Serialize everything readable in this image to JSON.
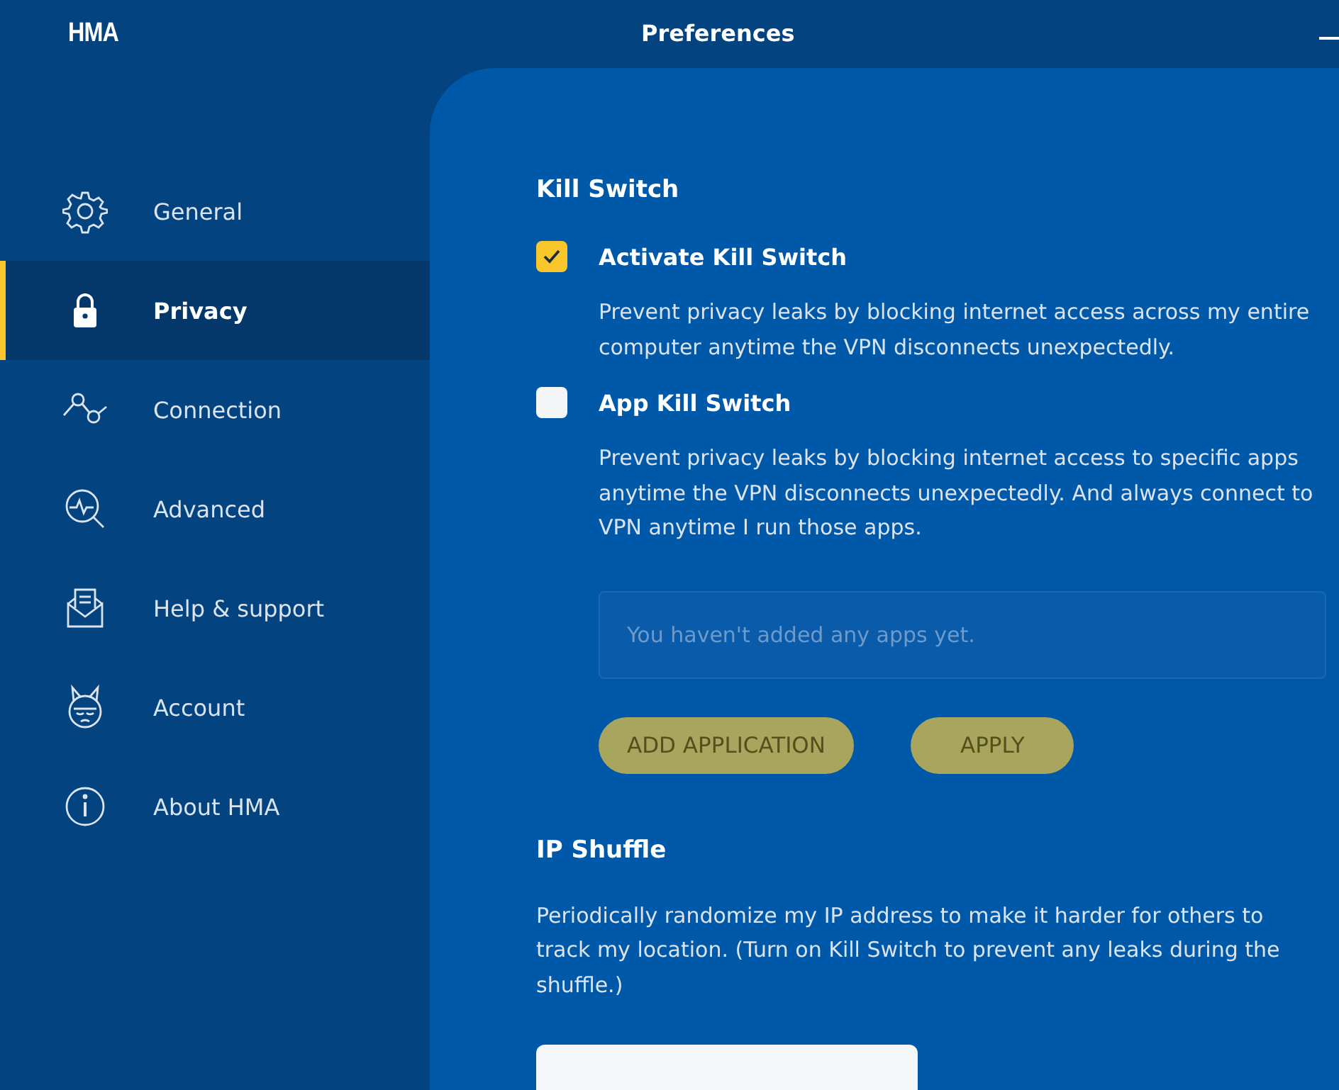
{
  "app": {
    "logo": "HMA",
    "title": "Preferences"
  },
  "sidebar": {
    "items": [
      {
        "label": "General",
        "kind": "gear",
        "selected": false
      },
      {
        "label": "Privacy",
        "kind": "lock",
        "selected": true
      },
      {
        "label": "Connection",
        "kind": "graph",
        "selected": false
      },
      {
        "label": "Advanced",
        "kind": "pulse",
        "selected": false
      },
      {
        "label": "Help & support",
        "kind": "mail",
        "selected": false
      },
      {
        "label": "Account",
        "kind": "mascot",
        "selected": false
      },
      {
        "label": "About HMA",
        "kind": "info",
        "selected": false
      }
    ]
  },
  "kill_switch": {
    "heading": "Kill Switch",
    "options": [
      {
        "label": "Activate Kill Switch",
        "checked": true,
        "description": "Prevent privacy leaks by blocking internet access across my entire computer anytime the VPN disconnects unexpectedly."
      },
      {
        "label": "App Kill Switch",
        "checked": false,
        "description": "Prevent privacy leaks by blocking internet access to specific apps anytime the VPN disconnects unexpectedly. And always connect to VPN anytime I run those apps."
      }
    ],
    "apps_list": {
      "placeholder": "You haven't added any apps yet."
    },
    "buttons": [
      {
        "label": "ADD APPLICATION",
        "disabled": true
      },
      {
        "label": "APPLY",
        "disabled": true
      }
    ]
  },
  "ip_shuffle": {
    "heading": "IP Shuffle",
    "description": "Periodically randomize my IP address to make it harder for others to track my location. (Turn on Kill Switch to prevent any leaks during the shuffle.)",
    "dropdown": {
      "kind": "select"
    }
  }
}
